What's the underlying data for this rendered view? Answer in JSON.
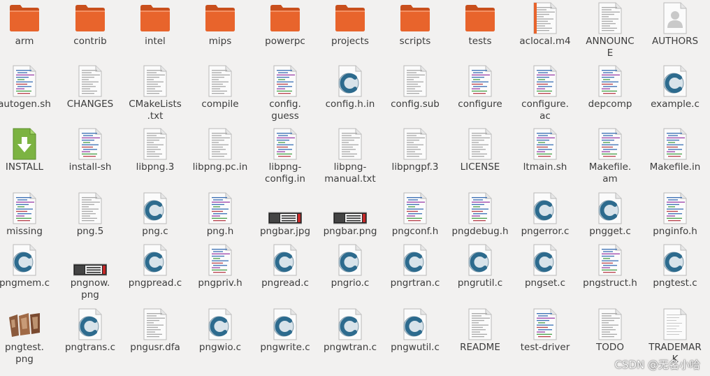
{
  "files": [
    {
      "name": "arm",
      "type": "folder"
    },
    {
      "name": "contrib",
      "type": "folder"
    },
    {
      "name": "intel",
      "type": "folder"
    },
    {
      "name": "mips",
      "type": "folder"
    },
    {
      "name": "powerpc",
      "type": "folder"
    },
    {
      "name": "projects",
      "type": "folder"
    },
    {
      "name": "scripts",
      "type": "folder"
    },
    {
      "name": "tests",
      "type": "folder"
    },
    {
      "name": "aclocal.m4",
      "type": "m4"
    },
    {
      "name": "ANNOUNC\nE",
      "type": "text"
    },
    {
      "name": "AUTHORS",
      "type": "authors"
    },
    {
      "name": "autogen.sh",
      "type": "script"
    },
    {
      "name": "CHANGES",
      "type": "text"
    },
    {
      "name": "CMakeLists\n.txt",
      "type": "text"
    },
    {
      "name": "compile",
      "type": "text"
    },
    {
      "name": "config.\nguess",
      "type": "script"
    },
    {
      "name": "config.h.in",
      "type": "c"
    },
    {
      "name": "config.sub",
      "type": "text"
    },
    {
      "name": "configure",
      "type": "script"
    },
    {
      "name": "configure.\nac",
      "type": "script"
    },
    {
      "name": "depcomp",
      "type": "script"
    },
    {
      "name": "example.c",
      "type": "c"
    },
    {
      "name": "INSTALL",
      "type": "install"
    },
    {
      "name": "install-sh",
      "type": "script"
    },
    {
      "name": "libpng.3",
      "type": "text"
    },
    {
      "name": "libpng.pc.in",
      "type": "text"
    },
    {
      "name": "libpng-\nconfig.in",
      "type": "script"
    },
    {
      "name": "libpng-\nmanual.txt",
      "type": "text"
    },
    {
      "name": "libpngpf.3",
      "type": "text"
    },
    {
      "name": "LICENSE",
      "type": "text"
    },
    {
      "name": "ltmain.sh",
      "type": "script"
    },
    {
      "name": "Makefile.\nam",
      "type": "script"
    },
    {
      "name": "Makefile.in",
      "type": "script"
    },
    {
      "name": "missing",
      "type": "script"
    },
    {
      "name": "png.5",
      "type": "text"
    },
    {
      "name": "png.c",
      "type": "c"
    },
    {
      "name": "png.h",
      "type": "script"
    },
    {
      "name": "pngbar.jpg",
      "type": "pngbar"
    },
    {
      "name": "pngbar.png",
      "type": "pngbar"
    },
    {
      "name": "pngconf.h",
      "type": "script"
    },
    {
      "name": "pngdebug.h",
      "type": "script"
    },
    {
      "name": "pngerror.c",
      "type": "c"
    },
    {
      "name": "pngget.c",
      "type": "c"
    },
    {
      "name": "pnginfo.h",
      "type": "script"
    },
    {
      "name": "pngmem.c",
      "type": "c"
    },
    {
      "name": "pngnow.\npng",
      "type": "pngbar"
    },
    {
      "name": "pngpread.c",
      "type": "c"
    },
    {
      "name": "pngpriv.h",
      "type": "script"
    },
    {
      "name": "pngread.c",
      "type": "c"
    },
    {
      "name": "pngrio.c",
      "type": "c"
    },
    {
      "name": "pngrtran.c",
      "type": "c"
    },
    {
      "name": "pngrutil.c",
      "type": "c"
    },
    {
      "name": "pngset.c",
      "type": "c"
    },
    {
      "name": "pngstruct.h",
      "type": "script"
    },
    {
      "name": "pngtest.c",
      "type": "c"
    },
    {
      "name": "pngtest.\npng",
      "type": "pngimg"
    },
    {
      "name": "pngtrans.c",
      "type": "c"
    },
    {
      "name": "pngusr.dfa",
      "type": "text"
    },
    {
      "name": "pngwio.c",
      "type": "c"
    },
    {
      "name": "pngwrite.c",
      "type": "c"
    },
    {
      "name": "pngwtran.c",
      "type": "c"
    },
    {
      "name": "pngwutil.c",
      "type": "c"
    },
    {
      "name": "README",
      "type": "text"
    },
    {
      "name": "test-driver",
      "type": "script"
    },
    {
      "name": "TODO",
      "type": "text"
    },
    {
      "name": "TRADEMAR\nK",
      "type": "plain"
    }
  ],
  "watermark": "CSDN @无名小哈",
  "colors": {
    "background": "#f2f1f0",
    "folder": "#e8642c",
    "folder_dark": "#c94f1c",
    "c_icon": "#2d6b8e",
    "install": "#7cb342"
  }
}
